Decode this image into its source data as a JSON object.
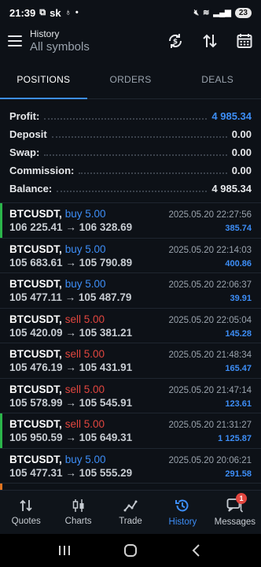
{
  "status": {
    "time": "21:39",
    "extra": "sk",
    "battery": "23"
  },
  "header": {
    "title": "History",
    "subtitle": "All symbols"
  },
  "tabs": [
    {
      "label": "POSITIONS"
    },
    {
      "label": "ORDERS"
    },
    {
      "label": "DEALS"
    }
  ],
  "summary": [
    {
      "label": "Profit:",
      "value": "4 985.34"
    },
    {
      "label": "Deposit",
      "value": "0.00"
    },
    {
      "label": "Swap:",
      "value": "0.00"
    },
    {
      "label": "Commission:",
      "value": "0.00"
    },
    {
      "label": "Balance:",
      "value": "4 985.34"
    }
  ],
  "deals": [
    {
      "symbol": "BTCUSDT,",
      "side": "buy 5.00",
      "time": "2025.05.20 22:27:56",
      "prices": "106 225.41 → 106 328.69",
      "profit": "385.74"
    },
    {
      "symbol": "BTCUSDT,",
      "side": "buy 5.00",
      "time": "2025.05.20 22:14:03",
      "prices": "105 683.61 → 105 790.89",
      "profit": "400.86"
    },
    {
      "symbol": "BTCUSDT,",
      "side": "buy 5.00",
      "time": "2025.05.20 22:06:37",
      "prices": "105 477.11 → 105 487.79",
      "profit": "39.91"
    },
    {
      "symbol": "BTCUSDT,",
      "side": "sell 5.00",
      "time": "2025.05.20 22:05:04",
      "prices": "105 420.09 → 105 381.21",
      "profit": "145.28"
    },
    {
      "symbol": "BTCUSDT,",
      "side": "sell 5.00",
      "time": "2025.05.20 21:48:34",
      "prices": "105 476.19 → 105 431.91",
      "profit": "165.47"
    },
    {
      "symbol": "BTCUSDT,",
      "side": "sell 5.00",
      "time": "2025.05.20 21:47:14",
      "prices": "105 578.99 → 105 545.91",
      "profit": "123.61"
    },
    {
      "symbol": "BTCUSDT,",
      "side": "sell 5.00",
      "time": "2025.05.20 21:31:27",
      "prices": "105 950.59 → 105 649.31",
      "profit": "1 125.87"
    },
    {
      "symbol": "BTCUSDT,",
      "side": "buy 5.00",
      "time": "2025.05.20 20:06:21",
      "prices": "105 477.31 → 105 555.29",
      "profit": "291.58"
    }
  ],
  "nav": [
    {
      "label": "Quotes"
    },
    {
      "label": "Charts"
    },
    {
      "label": "Trade"
    },
    {
      "label": "History"
    },
    {
      "label": "Messages",
      "badge": "1"
    }
  ],
  "colors": {
    "accent": "#3d8ef7",
    "sell": "#e2463f",
    "marker_green": "#2bb44a",
    "background": "#0d1117"
  }
}
